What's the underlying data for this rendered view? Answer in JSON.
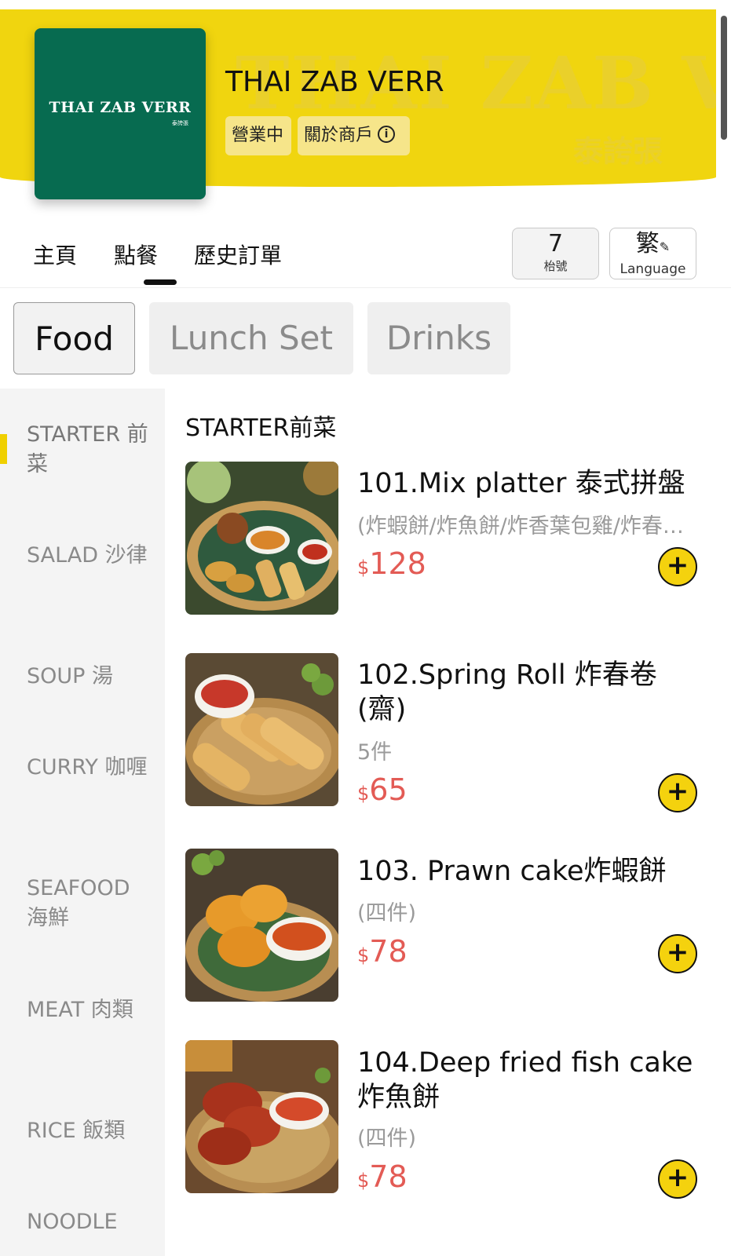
{
  "store": {
    "name": "THAI ZAB VERR",
    "logo_text": "THAI ZAB VERR",
    "logo_sub": "泰誇張",
    "banner_watermark": "THAI ZAB VERR",
    "banner_watermark_sub": "泰誇張",
    "status": "營業中",
    "about_label": "關於商戶",
    "brand_color": "#f0d50f",
    "logo_color": "#076b50"
  },
  "nav": {
    "tabs": [
      {
        "label": "主頁"
      },
      {
        "label": "點餐",
        "active": true
      },
      {
        "label": "歷史訂單"
      }
    ],
    "table_number": "7",
    "table_label": "枱號",
    "language_char": "繁",
    "language_label": "Language"
  },
  "categories": [
    {
      "label": "Food",
      "active": true
    },
    {
      "label": "Lunch Set"
    },
    {
      "label": "Drinks"
    }
  ],
  "sidebar": {
    "items": [
      {
        "label": "STARTER 前菜",
        "active": true
      },
      {
        "label": "SALAD 沙律"
      },
      {
        "label": "SOUP 湯"
      },
      {
        "label": "CURRY 咖喱"
      },
      {
        "label": "SEAFOOD 海鮮"
      },
      {
        "label": "MEAT 肉類"
      },
      {
        "label": "RICE 飯類"
      },
      {
        "label": "NOODLE"
      }
    ]
  },
  "menu": {
    "section_title": "STARTER前菜",
    "currency": "$",
    "price_color": "#e35b55",
    "add_icon": "plus-circle-icon",
    "dishes": [
      {
        "name": "101.Mix platter 泰式拼盤",
        "desc": "(炸蝦餅/炸魚餅/炸香葉包雞/炸春卷)",
        "price": "128"
      },
      {
        "name": "102.Spring Roll 炸春卷(齋)",
        "desc": "5件",
        "price": "65"
      },
      {
        "name": "103. Prawn cake炸蝦餅",
        "desc": "(四件)",
        "price": "78"
      },
      {
        "name": "104.Deep fried fish cake 炸魚餅",
        "desc": "(四件)",
        "price": "78"
      }
    ]
  }
}
